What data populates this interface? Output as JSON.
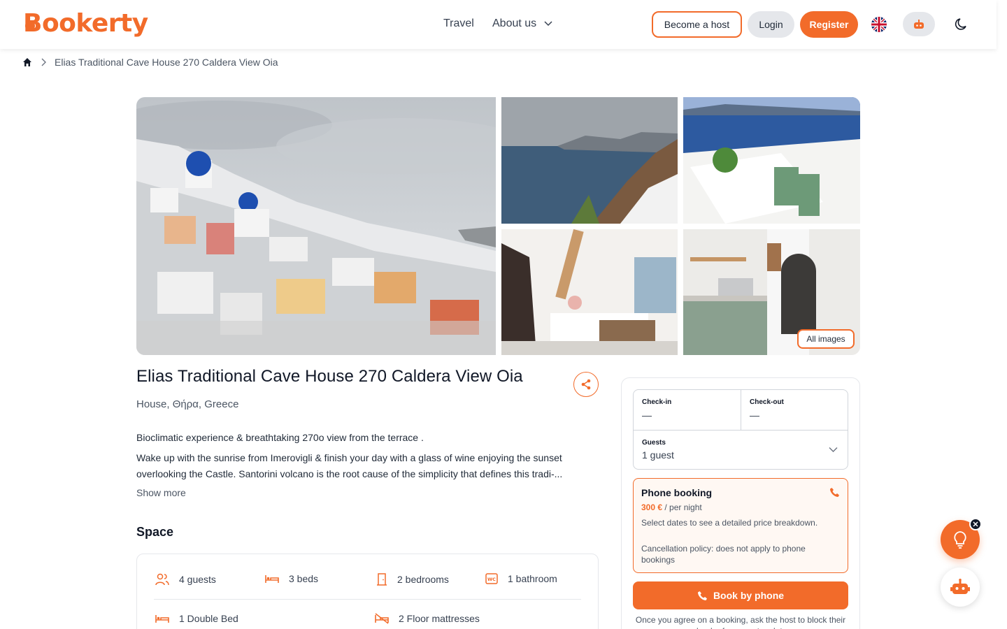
{
  "brand": {
    "name": "Bookerty",
    "accent_color": "#f26b2a"
  },
  "nav": {
    "travel": "Travel",
    "about": "About us",
    "become_host": "Become a host",
    "login": "Login",
    "register": "Register",
    "language_flag": "uk-flag-icon",
    "assistant_icon": "robot-icon",
    "theme_icon": "moon-icon"
  },
  "breadcrumb": {
    "home_icon": "home-icon",
    "current": "Elias Traditional Cave House 270 Caldera View Oia"
  },
  "gallery": {
    "all_images": "All images"
  },
  "listing": {
    "title": "Elias Traditional Cave House 270 Caldera View Oia",
    "subtitle": "House, Θήρα, Greece",
    "description_line1": "Bioclimatic experience & breathtaking 270o view from the terrace .",
    "description_line2": "Wake up with the sunrise from Imerovigli & finish your day with a glass of wine enjoying the sunset overlooking the Castle. Santorini volcano is the root cause of the simplicity that defines this tradi-...",
    "show_more": "Show more"
  },
  "space": {
    "heading": "Space",
    "guests": "4 guests",
    "beds": "3 beds",
    "bedrooms": "2 bedrooms",
    "bathroom": "1 bathroom",
    "double_bed": "1 Double Bed",
    "floor_mattresses": "2 Floor mattresses"
  },
  "booking": {
    "checkin_label": "Check-in",
    "checkin_value": "—",
    "checkout_label": "Check-out",
    "checkout_value": "—",
    "guests_label": "Guests",
    "guests_value": "1 guest",
    "phone_title": "Phone booking",
    "price": "300 €",
    "price_unit": " / per night",
    "price_note": "Select dates to see a detailed price breakdown.",
    "cancel_note": "Cancellation policy: does not apply to phone bookings",
    "book_button": "Book by phone",
    "book_note": "Once you agree on a booking, ask the host to block their calendar for your stay dates."
  }
}
